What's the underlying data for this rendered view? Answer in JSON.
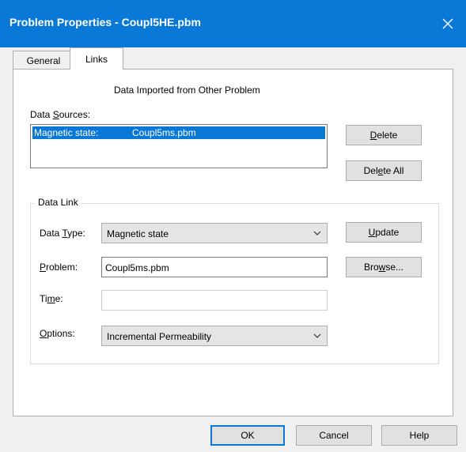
{
  "window": {
    "title": "Problem Properties - Coupl5HE.pbm"
  },
  "tabs": {
    "general": "General",
    "links": "Links"
  },
  "links": {
    "heading": "Data Imported from Other Problem",
    "sources_label_pre": "Data ",
    "sources_label_acc": "S",
    "sources_label_post": "ources:",
    "source_row": {
      "type": "Magnetic state:",
      "file": "Coupl5ms.pbm"
    },
    "delete_acc": "D",
    "delete_rest": "elete",
    "delete_all_pre": "Del",
    "delete_all_acc": "e",
    "delete_all_post": "te All",
    "group_label": "Data Link",
    "data_type_pre": "Data ",
    "data_type_acc": "T",
    "data_type_post": "ype:",
    "data_type_value": "Magnetic state",
    "update_acc": "U",
    "update_rest": "pdate",
    "problem_acc": "P",
    "problem_rest": "roblem:",
    "problem_value": "Coupl5ms.pbm",
    "browse_pre": "Bro",
    "browse_acc": "w",
    "browse_post": "se...",
    "time_pre": "Ti",
    "time_acc": "m",
    "time_post": "e:",
    "time_value": "",
    "options_acc": "O",
    "options_rest": "ptions:",
    "options_value": "Incremental Permeability"
  },
  "footer": {
    "ok": "OK",
    "cancel": "Cancel",
    "help": "Help"
  }
}
